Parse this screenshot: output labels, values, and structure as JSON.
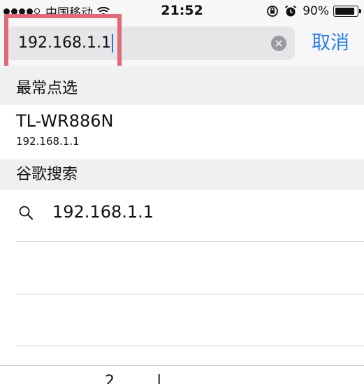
{
  "status_bar": {
    "carrier": "中国移动",
    "time": "21:52",
    "battery": "90%",
    "icons": [
      "signal-icon",
      "wifi-icon",
      "orientation-lock-icon",
      "alarm-icon",
      "battery-icon"
    ]
  },
  "search": {
    "value": "192.168.1.1",
    "cancel_label": "取消",
    "highlight_color": "#e06a7a"
  },
  "favorites": {
    "header": "最常点选",
    "items": [
      {
        "title": "TL-WR886N",
        "url": "192.168.1.1"
      }
    ]
  },
  "google_search": {
    "header": "谷歌搜索",
    "suggestions": [
      {
        "text": "192.168.1.1",
        "icon": "search-icon"
      }
    ]
  },
  "keyboard_partial": {
    "glyphs": [
      "2",
      "|"
    ]
  },
  "colors": {
    "accent": "#2a7ee8",
    "caret": "#2a6ee6",
    "highlight": "#e06a7a"
  }
}
